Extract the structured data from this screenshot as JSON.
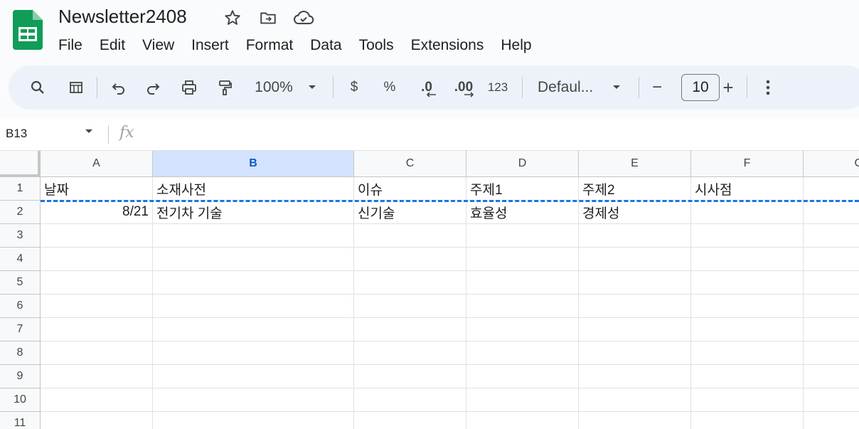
{
  "app": {
    "doc_title": "Newsletter2408",
    "accent_color": "#0f9d58",
    "title_icons": [
      "star-icon",
      "move-folder-icon",
      "cloud-status-icon"
    ]
  },
  "menu": [
    "File",
    "Edit",
    "View",
    "Insert",
    "Format",
    "Data",
    "Tools",
    "Extensions",
    "Help"
  ],
  "toolbar": {
    "zoom": "100%",
    "currency": "$",
    "percent": "%",
    "decrease_decimal": ".0",
    "increase_decimal": ".00",
    "number_format": "123",
    "font": "Defaul...",
    "font_size": "10",
    "minus": "−",
    "plus": "+"
  },
  "formula_bar": {
    "name_box": "B13",
    "fx": "fx",
    "value": ""
  },
  "sheet": {
    "columns": [
      "A",
      "B",
      "C",
      "D",
      "E",
      "F",
      "G"
    ],
    "selected_column": "B",
    "rows": [
      "1",
      "2",
      "3",
      "4",
      "5",
      "6",
      "7",
      "8",
      "9",
      "10",
      "11"
    ],
    "row1": [
      "날짜",
      "소재사전",
      "이슈",
      "주제1",
      "주제2",
      "시사점"
    ],
    "row2": [
      "8/21",
      "전기차 기술",
      "신기술",
      "효율성",
      "경제성",
      ""
    ]
  }
}
